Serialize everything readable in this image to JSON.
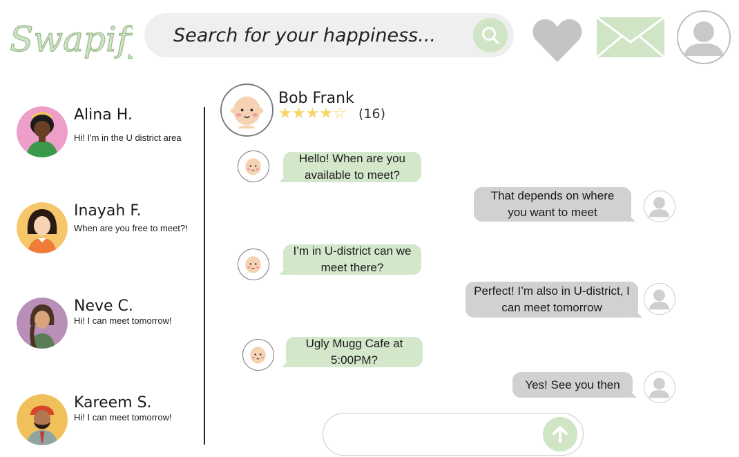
{
  "app": {
    "logo_text": "Swapify",
    "accent_color": "#cfe5c6",
    "bubble_incoming_color": "#d3e7cb",
    "bubble_outgoing_color": "#d1d1d1"
  },
  "header": {
    "search": {
      "placeholder": "Search for your happiness...",
      "value": "",
      "icon": "search-icon"
    },
    "icons": [
      "heart-icon",
      "mail-icon",
      "user-profile-icon"
    ]
  },
  "sidebar": {
    "contacts": [
      {
        "name": "Alina H.",
        "preview": "Hi! I'm in the U district area"
      },
      {
        "name": "Inayah F.",
        "preview": "When are you free to meet?!"
      },
      {
        "name": "Neve C.",
        "preview": "Hi! I can meet tomorrow!"
      },
      {
        "name": "Kareem S.",
        "preview": "Hi! I can meet tomorrow!"
      }
    ]
  },
  "chat": {
    "partner": {
      "name": "Bob Frank",
      "rating": 4,
      "rating_max": 5,
      "review_count": "(16)"
    },
    "messages": [
      {
        "from": "Bob Frank",
        "text": "Hello! When are you available to meet?"
      },
      {
        "from": "me",
        "text": "That depends on where you want to meet"
      },
      {
        "from": "Bob Frank",
        "text": "I’m in U-district can we meet there?"
      },
      {
        "from": "me",
        "text": "Perfect! I’m also in U-district, I can meet tomorrow"
      },
      {
        "from": "Bob Frank",
        "text": "Ugly Mugg Cafe at 5:00PM?"
      },
      {
        "from": "me",
        "text": "Yes! See you then"
      }
    ],
    "composer": {
      "value": "",
      "placeholder": "",
      "send_icon": "arrow-up-icon"
    }
  }
}
